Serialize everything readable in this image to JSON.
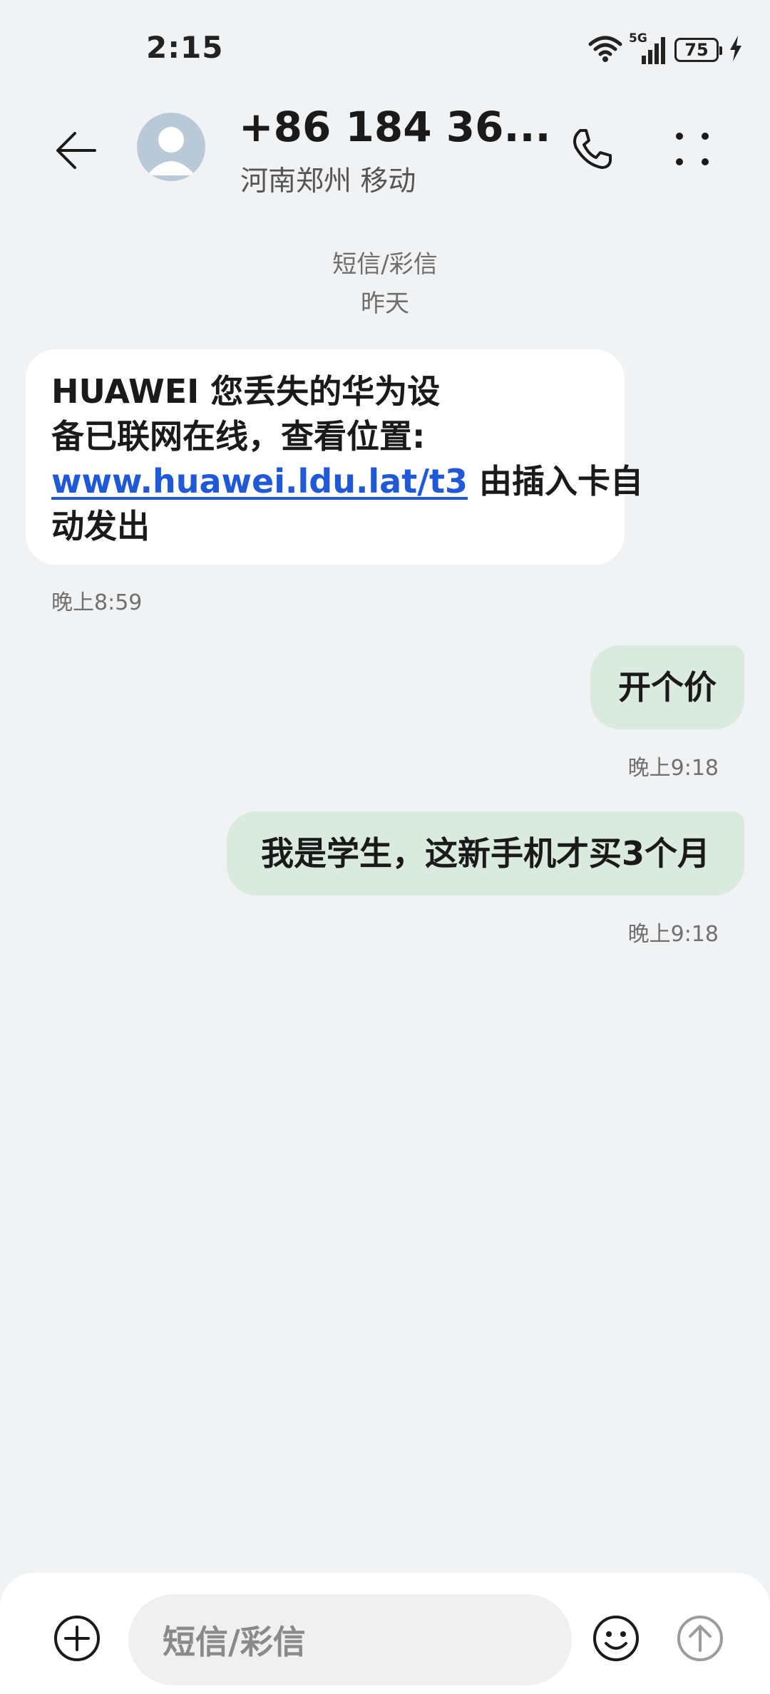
{
  "status_bar": {
    "time": "2:15",
    "network": "5G",
    "battery": "75"
  },
  "header": {
    "contact_name": "+86 184 36...",
    "contact_subtitle": "河南郑州 移动"
  },
  "conversation": {
    "type_label": "短信/彩信",
    "date_label": "昨天"
  },
  "messages": [
    {
      "direction": "incoming",
      "lines": [
        "HUAWEI 您丢失的华为设",
        "备已联网在线，查看位置:"
      ],
      "link": "www.huawei.ldu.lat/t3",
      "after_link": " 由插入卡自",
      "last_line": "动发出",
      "time": "晚上8:59"
    },
    {
      "direction": "outgoing",
      "text": "开个价",
      "time": "晚上9:18"
    },
    {
      "direction": "outgoing",
      "text": "我是学生，这新手机才买3个月",
      "time": "晚上9:18"
    }
  ],
  "composer": {
    "placeholder": "短信/彩信"
  },
  "icons": {
    "back": "arrow-left-icon",
    "call": "phone-icon",
    "more": "more-vertical-icon",
    "add": "plus-circle-icon",
    "emoji": "emoji-icon",
    "send": "arrow-up-circle-icon",
    "wifi": "wifi-icon",
    "signal": "signal-icon",
    "charging": "charging-bolt-icon"
  },
  "colors": {
    "background": "#f1f2f4",
    "incoming_bubble": "#ffffff",
    "outgoing_bubble": "#dbeadf",
    "link": "#2059d8"
  }
}
